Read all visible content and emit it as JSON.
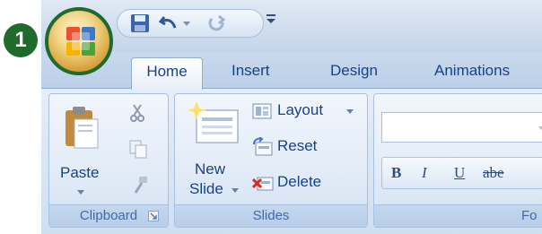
{
  "callout": {
    "number": "1"
  },
  "tabs": [
    {
      "label": "Home",
      "active": true
    },
    {
      "label": "Insert"
    },
    {
      "label": "Design"
    },
    {
      "label": "Animations"
    }
  ],
  "clipboard": {
    "paste_label": "Paste",
    "group_label": "Clipboard"
  },
  "slides": {
    "new_slide_line1": "New",
    "new_slide_line2": "Slide",
    "layout_label": "Layout",
    "reset_label": "Reset",
    "delete_label": "Delete",
    "group_label": "Slides"
  },
  "font": {
    "bold": "B",
    "italic": "I",
    "underline": "U",
    "strike": "abe",
    "group_label": "Fo"
  },
  "icons": {
    "office_button": "office-logo-icon",
    "save": "save-icon",
    "undo": "undo-icon",
    "redo": "redo-icon",
    "customize": "customize-qat-icon"
  },
  "colors": {
    "callout_green": "#1f6b2e",
    "tab_text": "#15428b",
    "ribbon_border": "#8faed6"
  }
}
